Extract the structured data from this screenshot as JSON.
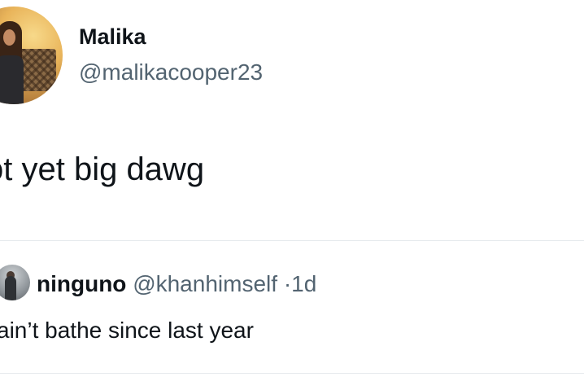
{
  "author": {
    "display_name": "Malika",
    "handle": "@malikacooper23"
  },
  "tweet": {
    "text": "ot yet big dawg"
  },
  "quoted_tweet": {
    "display_name": "ninguno",
    "handle": "@khanhimself",
    "separator": "·",
    "time": "1d",
    "text": "ain’t bathe since last year"
  },
  "colors": {
    "primary_text": "#0f1419",
    "secondary_text": "#536471",
    "divider": "#e6eaed",
    "background": "#ffffff"
  }
}
